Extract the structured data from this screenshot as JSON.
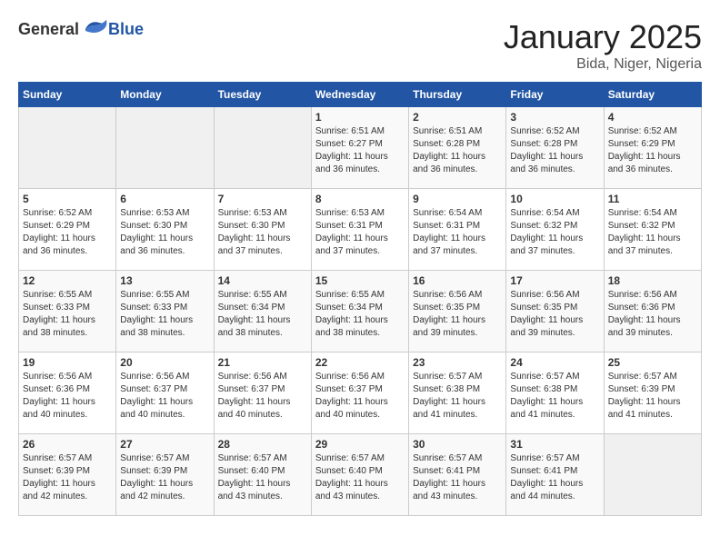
{
  "header": {
    "logo_general": "General",
    "logo_blue": "Blue",
    "month": "January 2025",
    "location": "Bida, Niger, Nigeria"
  },
  "weekdays": [
    "Sunday",
    "Monday",
    "Tuesday",
    "Wednesday",
    "Thursday",
    "Friday",
    "Saturday"
  ],
  "weeks": [
    [
      {
        "day": "",
        "sunrise": "",
        "sunset": "",
        "daylight": ""
      },
      {
        "day": "",
        "sunrise": "",
        "sunset": "",
        "daylight": ""
      },
      {
        "day": "",
        "sunrise": "",
        "sunset": "",
        "daylight": ""
      },
      {
        "day": "1",
        "sunrise": "Sunrise: 6:51 AM",
        "sunset": "Sunset: 6:27 PM",
        "daylight": "Daylight: 11 hours and 36 minutes."
      },
      {
        "day": "2",
        "sunrise": "Sunrise: 6:51 AM",
        "sunset": "Sunset: 6:28 PM",
        "daylight": "Daylight: 11 hours and 36 minutes."
      },
      {
        "day": "3",
        "sunrise": "Sunrise: 6:52 AM",
        "sunset": "Sunset: 6:28 PM",
        "daylight": "Daylight: 11 hours and 36 minutes."
      },
      {
        "day": "4",
        "sunrise": "Sunrise: 6:52 AM",
        "sunset": "Sunset: 6:29 PM",
        "daylight": "Daylight: 11 hours and 36 minutes."
      }
    ],
    [
      {
        "day": "5",
        "sunrise": "Sunrise: 6:52 AM",
        "sunset": "Sunset: 6:29 PM",
        "daylight": "Daylight: 11 hours and 36 minutes."
      },
      {
        "day": "6",
        "sunrise": "Sunrise: 6:53 AM",
        "sunset": "Sunset: 6:30 PM",
        "daylight": "Daylight: 11 hours and 36 minutes."
      },
      {
        "day": "7",
        "sunrise": "Sunrise: 6:53 AM",
        "sunset": "Sunset: 6:30 PM",
        "daylight": "Daylight: 11 hours and 37 minutes."
      },
      {
        "day": "8",
        "sunrise": "Sunrise: 6:53 AM",
        "sunset": "Sunset: 6:31 PM",
        "daylight": "Daylight: 11 hours and 37 minutes."
      },
      {
        "day": "9",
        "sunrise": "Sunrise: 6:54 AM",
        "sunset": "Sunset: 6:31 PM",
        "daylight": "Daylight: 11 hours and 37 minutes."
      },
      {
        "day": "10",
        "sunrise": "Sunrise: 6:54 AM",
        "sunset": "Sunset: 6:32 PM",
        "daylight": "Daylight: 11 hours and 37 minutes."
      },
      {
        "day": "11",
        "sunrise": "Sunrise: 6:54 AM",
        "sunset": "Sunset: 6:32 PM",
        "daylight": "Daylight: 11 hours and 37 minutes."
      }
    ],
    [
      {
        "day": "12",
        "sunrise": "Sunrise: 6:55 AM",
        "sunset": "Sunset: 6:33 PM",
        "daylight": "Daylight: 11 hours and 38 minutes."
      },
      {
        "day": "13",
        "sunrise": "Sunrise: 6:55 AM",
        "sunset": "Sunset: 6:33 PM",
        "daylight": "Daylight: 11 hours and 38 minutes."
      },
      {
        "day": "14",
        "sunrise": "Sunrise: 6:55 AM",
        "sunset": "Sunset: 6:34 PM",
        "daylight": "Daylight: 11 hours and 38 minutes."
      },
      {
        "day": "15",
        "sunrise": "Sunrise: 6:55 AM",
        "sunset": "Sunset: 6:34 PM",
        "daylight": "Daylight: 11 hours and 38 minutes."
      },
      {
        "day": "16",
        "sunrise": "Sunrise: 6:56 AM",
        "sunset": "Sunset: 6:35 PM",
        "daylight": "Daylight: 11 hours and 39 minutes."
      },
      {
        "day": "17",
        "sunrise": "Sunrise: 6:56 AM",
        "sunset": "Sunset: 6:35 PM",
        "daylight": "Daylight: 11 hours and 39 minutes."
      },
      {
        "day": "18",
        "sunrise": "Sunrise: 6:56 AM",
        "sunset": "Sunset: 6:36 PM",
        "daylight": "Daylight: 11 hours and 39 minutes."
      }
    ],
    [
      {
        "day": "19",
        "sunrise": "Sunrise: 6:56 AM",
        "sunset": "Sunset: 6:36 PM",
        "daylight": "Daylight: 11 hours and 40 minutes."
      },
      {
        "day": "20",
        "sunrise": "Sunrise: 6:56 AM",
        "sunset": "Sunset: 6:37 PM",
        "daylight": "Daylight: 11 hours and 40 minutes."
      },
      {
        "day": "21",
        "sunrise": "Sunrise: 6:56 AM",
        "sunset": "Sunset: 6:37 PM",
        "daylight": "Daylight: 11 hours and 40 minutes."
      },
      {
        "day": "22",
        "sunrise": "Sunrise: 6:56 AM",
        "sunset": "Sunset: 6:37 PM",
        "daylight": "Daylight: 11 hours and 40 minutes."
      },
      {
        "day": "23",
        "sunrise": "Sunrise: 6:57 AM",
        "sunset": "Sunset: 6:38 PM",
        "daylight": "Daylight: 11 hours and 41 minutes."
      },
      {
        "day": "24",
        "sunrise": "Sunrise: 6:57 AM",
        "sunset": "Sunset: 6:38 PM",
        "daylight": "Daylight: 11 hours and 41 minutes."
      },
      {
        "day": "25",
        "sunrise": "Sunrise: 6:57 AM",
        "sunset": "Sunset: 6:39 PM",
        "daylight": "Daylight: 11 hours and 41 minutes."
      }
    ],
    [
      {
        "day": "26",
        "sunrise": "Sunrise: 6:57 AM",
        "sunset": "Sunset: 6:39 PM",
        "daylight": "Daylight: 11 hours and 42 minutes."
      },
      {
        "day": "27",
        "sunrise": "Sunrise: 6:57 AM",
        "sunset": "Sunset: 6:39 PM",
        "daylight": "Daylight: 11 hours and 42 minutes."
      },
      {
        "day": "28",
        "sunrise": "Sunrise: 6:57 AM",
        "sunset": "Sunset: 6:40 PM",
        "daylight": "Daylight: 11 hours and 43 minutes."
      },
      {
        "day": "29",
        "sunrise": "Sunrise: 6:57 AM",
        "sunset": "Sunset: 6:40 PM",
        "daylight": "Daylight: 11 hours and 43 minutes."
      },
      {
        "day": "30",
        "sunrise": "Sunrise: 6:57 AM",
        "sunset": "Sunset: 6:41 PM",
        "daylight": "Daylight: 11 hours and 43 minutes."
      },
      {
        "day": "31",
        "sunrise": "Sunrise: 6:57 AM",
        "sunset": "Sunset: 6:41 PM",
        "daylight": "Daylight: 11 hours and 44 minutes."
      },
      {
        "day": "",
        "sunrise": "",
        "sunset": "",
        "daylight": ""
      }
    ]
  ]
}
